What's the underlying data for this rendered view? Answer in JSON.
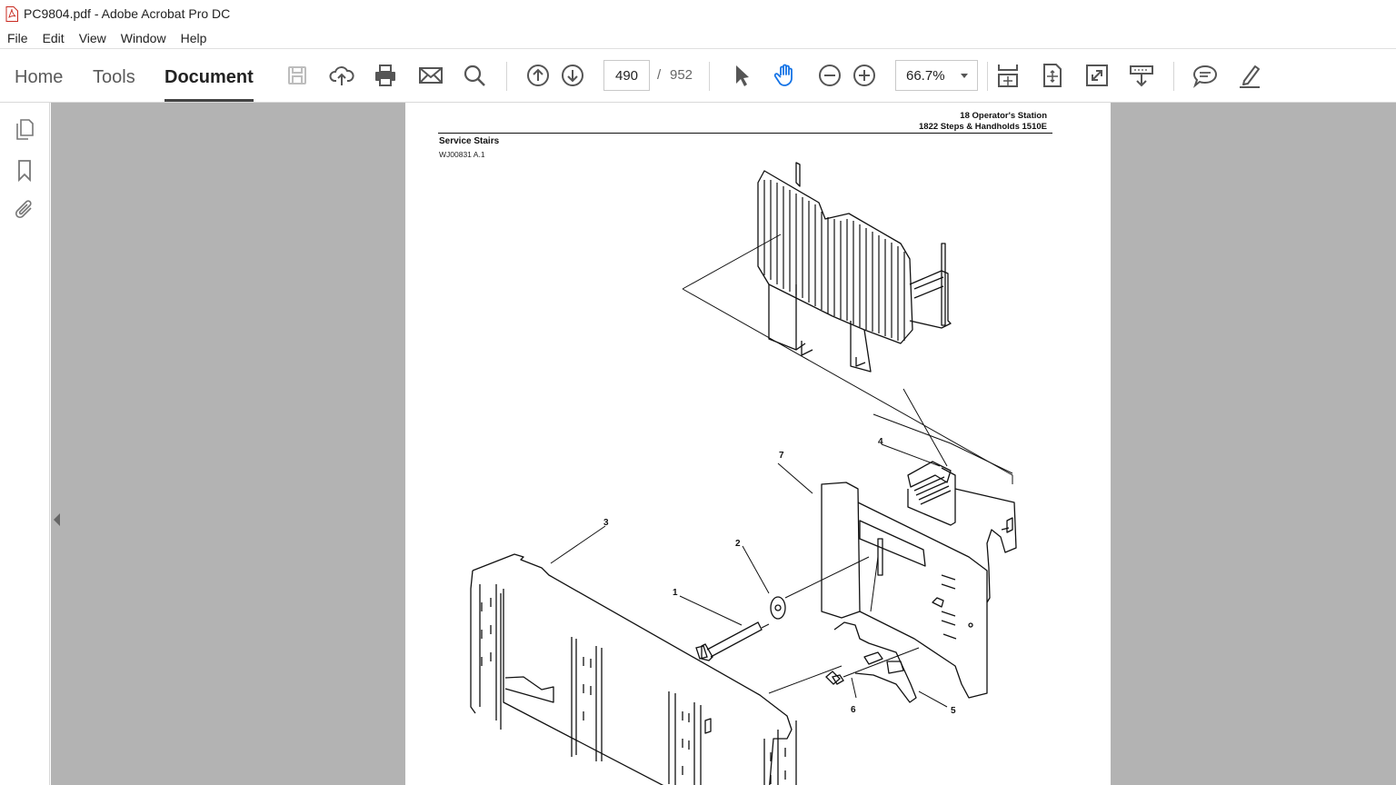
{
  "window": {
    "title": "PC9804.pdf - Adobe Acrobat Pro DC"
  },
  "menu": [
    "File",
    "Edit",
    "View",
    "Window",
    "Help"
  ],
  "tabs": {
    "home": "Home",
    "tools": "Tools",
    "document": "Document"
  },
  "toolbar_icons": [
    "save-icon",
    "cloud-upload-icon",
    "print-icon",
    "email-icon",
    "search-icon",
    "page-up-icon",
    "page-down-icon",
    "select-arrow-icon",
    "hand-icon",
    "zoom-out-icon",
    "zoom-in-icon",
    "scroll-mode-icon",
    "fit-page-icon",
    "fullscreen-icon",
    "read-mode-icon",
    "comment-icon",
    "highlight-pen-icon"
  ],
  "navigation": {
    "current_page": "490",
    "separator": "/",
    "total_pages": "952"
  },
  "zoom": {
    "value": "66.7%"
  },
  "left_panel_icons": [
    "pages-icon",
    "bookmark-icon",
    "attachment-icon"
  ],
  "document": {
    "header_line1": "18 Operator's Station",
    "header_line2": "1822 Steps & Handholds 1510E",
    "section_title": "Service Stairs",
    "figure_code": "WJ00831 A.1",
    "callouts": [
      "1",
      "2",
      "3",
      "4",
      "5",
      "6",
      "7"
    ]
  }
}
